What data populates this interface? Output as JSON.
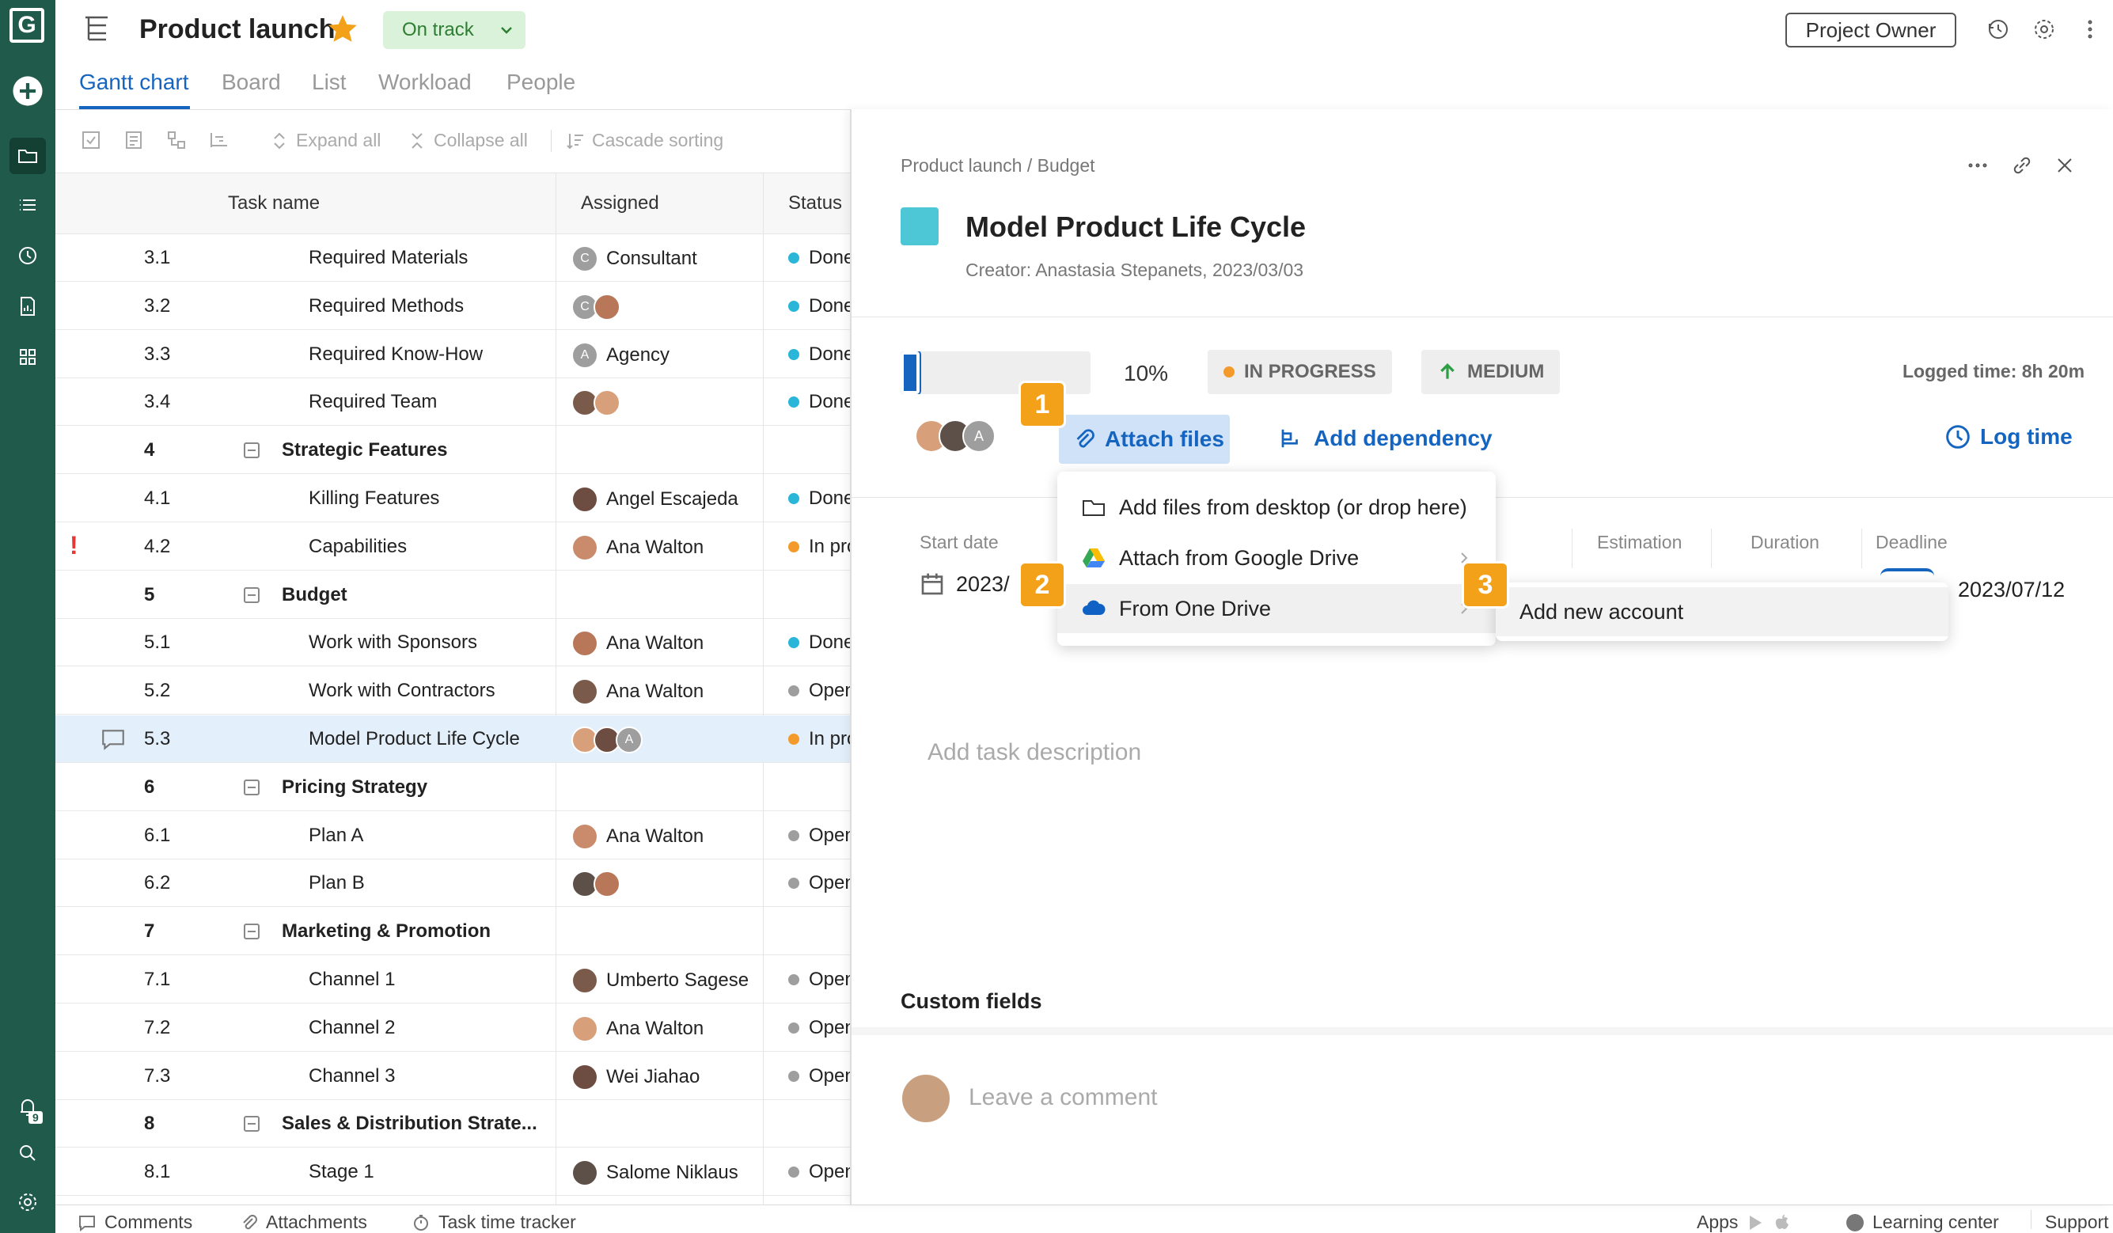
{
  "app": {
    "logo_letter": "G",
    "title": "Product launch",
    "status": "On track",
    "owner_button": "Project Owner",
    "notif_count": "9"
  },
  "tabs": [
    "Gantt chart",
    "Board",
    "List",
    "Workload",
    "People"
  ],
  "toolbar": {
    "expand_all": "Expand all",
    "collapse_all": "Collapse all",
    "cascade_sorting": "Cascade sorting"
  },
  "table": {
    "headers": {
      "task_name": "Task name",
      "assigned": "Assigned",
      "status": "Status"
    },
    "rows": [
      {
        "num": "3.1",
        "name": "Required Materials",
        "assignee": "Consultant",
        "status": "Done"
      },
      {
        "num": "3.2",
        "name": "Required Methods",
        "assignee": "",
        "status": "Done"
      },
      {
        "num": "3.3",
        "name": "Required Know-How",
        "assignee": "Agency",
        "status": "Done"
      },
      {
        "num": "3.4",
        "name": "Required Team",
        "assignee": "",
        "status": "Done"
      },
      {
        "num": "4",
        "name": "Strategic Features",
        "assignee": "",
        "status": ""
      },
      {
        "num": "4.1",
        "name": "Killing Features",
        "assignee": "Angel Escajeda",
        "status": "Done"
      },
      {
        "num": "4.2",
        "name": "Capabilities",
        "assignee": "Ana Walton",
        "status": "In progress"
      },
      {
        "num": "5",
        "name": "Budget",
        "assignee": "",
        "status": ""
      },
      {
        "num": "5.1",
        "name": "Work with Sponsors",
        "assignee": "Ana Walton",
        "status": "Done"
      },
      {
        "num": "5.2",
        "name": "Work with Contractors",
        "assignee": "Ana Walton",
        "status": "Open"
      },
      {
        "num": "5.3",
        "name": "Model Product Life Cycle",
        "assignee": "",
        "status": "In progress"
      },
      {
        "num": "6",
        "name": "Pricing Strategy",
        "assignee": "",
        "status": ""
      },
      {
        "num": "6.1",
        "name": "Plan A",
        "assignee": "Ana Walton",
        "status": "Open"
      },
      {
        "num": "6.2",
        "name": "Plan B",
        "assignee": "",
        "status": "Open"
      },
      {
        "num": "7",
        "name": "Marketing & Promotion",
        "assignee": "",
        "status": ""
      },
      {
        "num": "7.1",
        "name": "Channel 1",
        "assignee": "Umberto Sagese",
        "status": "Open"
      },
      {
        "num": "7.2",
        "name": "Channel 2",
        "assignee": "Ana Walton",
        "status": "Open"
      },
      {
        "num": "7.3",
        "name": "Channel 3",
        "assignee": "Wei Jiahao",
        "status": "Open"
      },
      {
        "num": "8",
        "name": "Sales & Distribution Strate...",
        "assignee": "",
        "status": ""
      },
      {
        "num": "8.1",
        "name": "Stage 1",
        "assignee": "Salome Niklaus",
        "status": "Open"
      }
    ]
  },
  "avatar_letters": {
    "consultant": "C",
    "agency": "A"
  },
  "colors": {
    "rail": "#1f5a4a",
    "accent": "#1565c0",
    "done": "#29b6d8",
    "in_progress": "#f39a2b",
    "open": "#9e9e9e",
    "marker": "#f4a11a",
    "task_color": "#4dc6d6"
  },
  "panel": {
    "breadcrumb": "Product launch / Budget",
    "task_title": "Model Product Life Cycle",
    "creator": "Creator: Anastasia Stepanets, 2023/03/03",
    "progress": 0.1,
    "progress_label": "10%",
    "status_badge": "IN PROGRESS",
    "priority_badge": "MEDIUM",
    "logged_time": "Logged time: 8h 20m",
    "attach_files": "Attach files",
    "add_dependency": "Add dependency",
    "log_time": "Log time",
    "fields": {
      "start_date": "Start date",
      "estimation": "Estimation",
      "duration": "Duration",
      "deadline": "Deadline",
      "start_value": "2023/",
      "deadline_value": "2023/07/12"
    },
    "description_placeholder": "Add task description",
    "custom_fields": "Custom fields",
    "comment_placeholder": "Leave a comment"
  },
  "attach_menu": {
    "items": [
      "Add files from desktop (or drop here)",
      "Attach from Google Drive",
      "From One Drive"
    ],
    "submenu": "Add new account"
  },
  "markers": [
    "1",
    "2",
    "3"
  ],
  "bottom_bar": {
    "comments": "Comments",
    "attachments": "Attachments",
    "task_time_tracker": "Task time tracker",
    "apps": "Apps",
    "learning_center": "Learning center",
    "support": "Support"
  }
}
